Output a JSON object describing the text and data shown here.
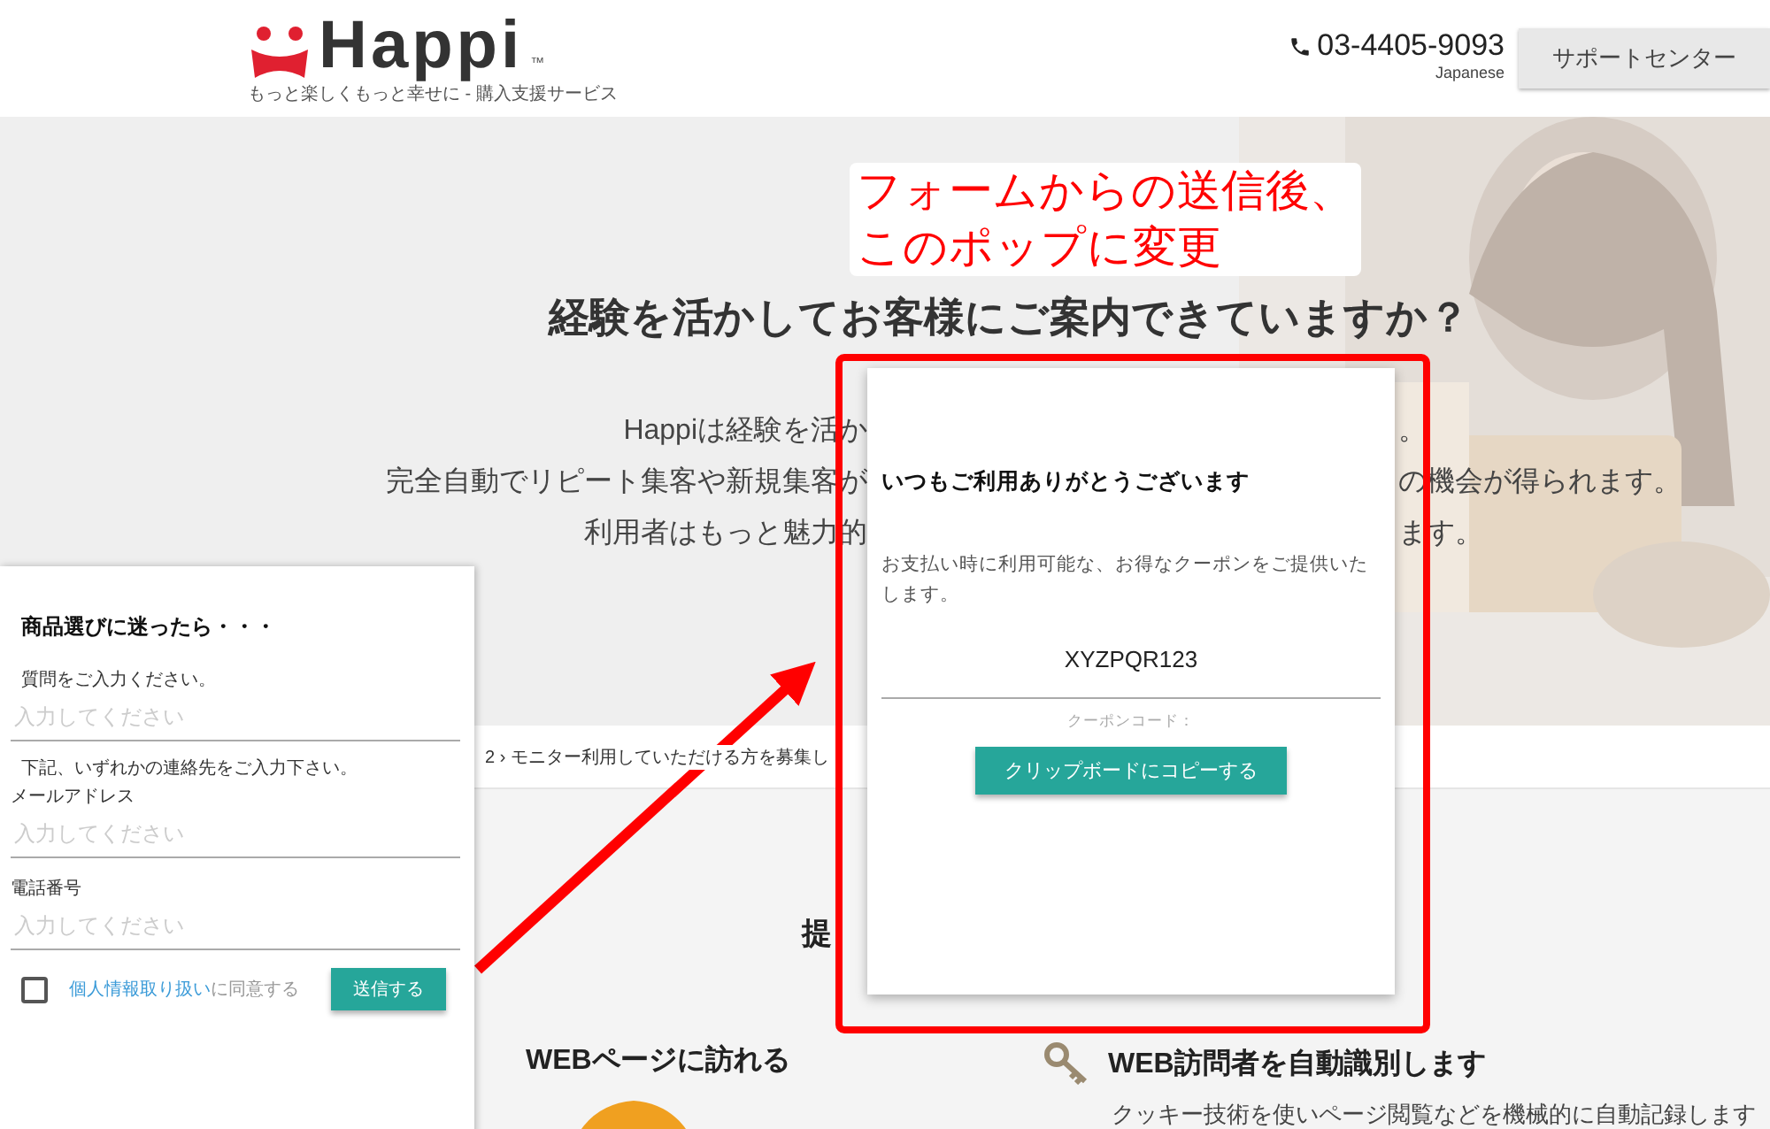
{
  "header": {
    "logo_name": "Happi",
    "logo_tm": "™",
    "tagline": "もっと楽しくもっと幸せに - 購入支援サービス",
    "phone": "03-4405-9093",
    "language": "Japanese",
    "support_button": "サポートセンター"
  },
  "hero": {
    "headline": "経験を活かしてお客様にご案内できていますか？",
    "lines": [
      {
        "left": "Happiは経験を活か",
        "right": "。"
      },
      {
        "left": "完全自動でリピート集客や新規集客が",
        "right": "の機会が得られます。"
      },
      {
        "left": "利用者はもっと魅力的",
        "right": "ます。"
      }
    ]
  },
  "breadcrumb": "2 › モニター利用していただける方を募集し",
  "section": {
    "heading": "提",
    "features": [
      {
        "kind": "visit",
        "title": "WEBページに訪れる"
      },
      {
        "kind": "identify",
        "title": "WEB訪問者を自動識別します",
        "description": "クッキー技術を使いページ閲覧などを機械的に自動記録します"
      }
    ]
  },
  "form": {
    "title": "商品選びに迷ったら・・・",
    "items": [
      {
        "kind": "prompt",
        "text": "質問をご入力ください。"
      },
      {
        "kind": "input",
        "placeholder": "入力してください"
      },
      {
        "kind": "prompt",
        "text": "下記、いずれかの連絡先をご入力下さい。"
      },
      {
        "kind": "label",
        "text": "メールアドレス"
      },
      {
        "kind": "input",
        "placeholder": "入力してください"
      },
      {
        "kind": "label",
        "text": "電話番号"
      },
      {
        "kind": "input",
        "placeholder": "入力してください"
      }
    ],
    "consent": {
      "checked": false,
      "link": "個人情報取り扱い",
      "text": "に同意する"
    },
    "submit": "送信する"
  },
  "popup": {
    "title": "いつもご利用ありがとうございます",
    "message": "お支払い時に利用可能な、お得なクーポンをご提供いたします。",
    "coupon_code": "XYZPQR123",
    "coupon_label": "クーポンコード：",
    "copy_button": "クリップボードにコピーする"
  },
  "annotation": {
    "lines": [
      "フォームからの送信後、",
      "このポップに変更"
    ]
  }
}
